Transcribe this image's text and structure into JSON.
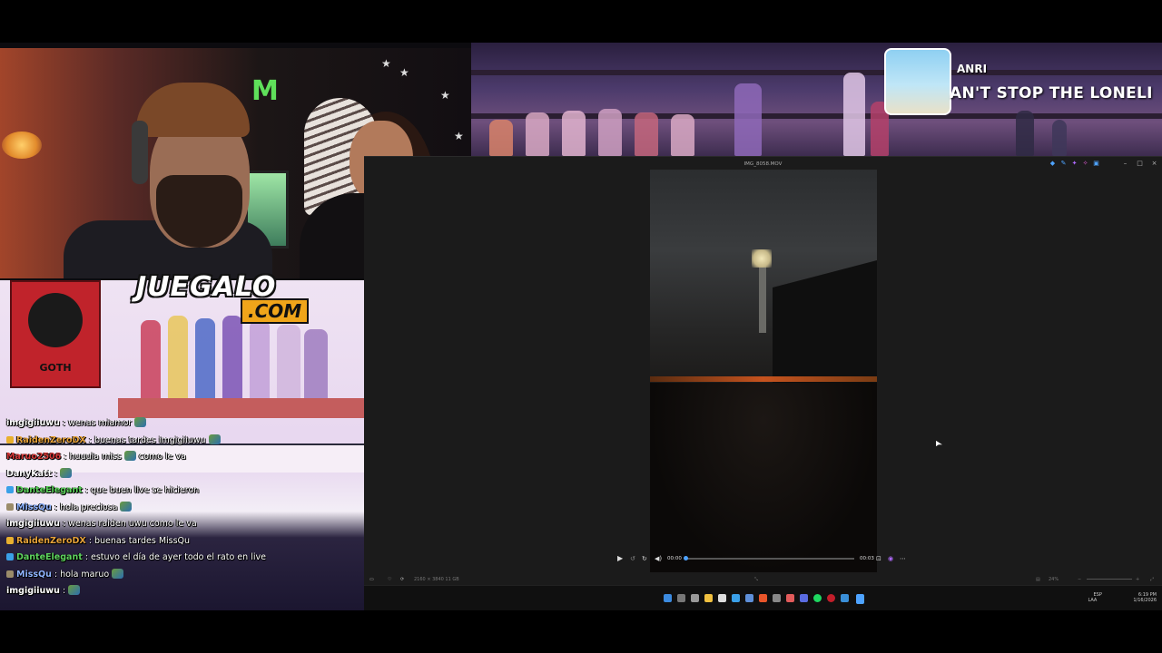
{
  "overlay": {
    "logo_main": "JUEGALO",
    "logo_sub": ".COM",
    "goth_sign": "GOTH"
  },
  "now_playing": {
    "artist": "ANRI",
    "title": "AN'T STOP THE LONELI"
  },
  "chat": {
    "messages": [
      {
        "user": "imgigiiuwu",
        "user_color": "#ffffff",
        "badge": "",
        "text": ": wenas miamor",
        "emote": true
      },
      {
        "user": "RaidenZeroDX",
        "user_color": "#e6a23a",
        "badge": "b1",
        "text": ": buenas tardes imgigiiuwu",
        "emote": true
      },
      {
        "user": "Maruo2506",
        "user_color": "#d63a3a",
        "badge": "",
        "text": ": huuula miss",
        "emote": true,
        "text2": "como le va"
      },
      {
        "user": "DanyKatt",
        "user_color": "#ffffff",
        "badge": "",
        "text": ":",
        "emote": true
      },
      {
        "user": "DanteElegant",
        "user_color": "#5ed35e",
        "badge": "b2",
        "text": ": que buen live se hicieron",
        "emote": false
      },
      {
        "user": "MissQu",
        "user_color": "#8fb4ff",
        "badge": "b3",
        "text": ": hola preciosa",
        "emote": true
      },
      {
        "user": "imgigiiuwu",
        "user_color": "#ffffff",
        "badge": "",
        "text": ": wenas raiden uwu como le va",
        "emote": false
      },
      {
        "user": "RaidenZeroDX",
        "user_color": "#e6a23a",
        "badge": "b1",
        "text": ": buenas tardes MissQu",
        "emote": false
      },
      {
        "user": "DanteElegant",
        "user_color": "#5ed35e",
        "badge": "b2",
        "text": ": estuvo el día de ayer todo el rato en live",
        "emote": false
      },
      {
        "user": "MissQu",
        "user_color": "#8fb4ff",
        "badge": "b3",
        "text": ": hola maruo",
        "emote": true
      },
      {
        "user": "imgigiiuwu",
        "user_color": "#ffffff",
        "badge": "",
        "text": ":",
        "emote": true
      }
    ]
  },
  "player": {
    "window_title": "IMG_8058.MOV",
    "time_current": "00:00",
    "time_total": "00:03",
    "progress": 0.0,
    "info_left": "2160 × 3840   11 GB",
    "zoom": "24%"
  },
  "taskbar": {
    "lang": "ESP",
    "lang2": "LAA",
    "time": "6:19 PM",
    "date": "1/16/2026"
  },
  "colors": {
    "accent": "#4ea3ff",
    "logo_sub_bg": "#f0a51a"
  }
}
